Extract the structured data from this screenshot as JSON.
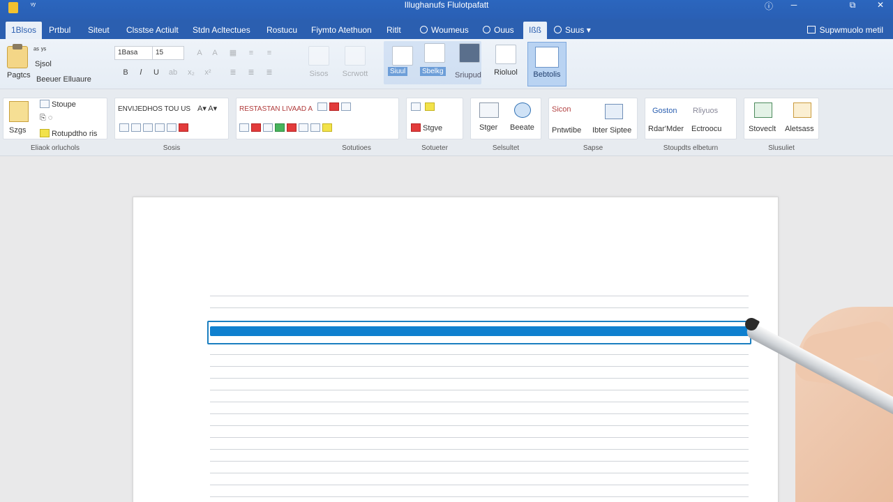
{
  "window": {
    "title": "Illughanufs  Flulotpafatt",
    "quick_access": "ᵛʸ",
    "buttons": {
      "help": "ⓘ",
      "minimize": "─",
      "restore": "⧉",
      "close": "✕"
    }
  },
  "tabs": [
    {
      "label": "1Blsos"
    },
    {
      "label": "Prtbul"
    },
    {
      "label": "Siteut"
    },
    {
      "label": "Clsstse Actiult"
    },
    {
      "label": "Stdn Acltectues"
    },
    {
      "label": "Rostucu"
    },
    {
      "label": "Fiymto Atethuon"
    },
    {
      "label": "Ritlt"
    },
    {
      "label": "Woumeus"
    },
    {
      "label": "Ouus"
    },
    {
      "label": "Ißß"
    },
    {
      "label": "Suus"
    }
  ],
  "share_label": "Supwmuolo metil",
  "ribbon_top": {
    "clipboard": {
      "paste": "Pagtcs",
      "line1": "ᵃˢ ʸˢ",
      "line2": "Sjsol",
      "line3": "Beeuer Elluaure"
    },
    "font_box": "1Basa",
    "size_box": "15",
    "big_buttons": [
      {
        "label": "Sisos"
      },
      {
        "label": "Scrwott"
      }
    ],
    "selection_labels": [
      "Siuul",
      "Sbelkg",
      "Sriupud"
    ],
    "extra_label": "Rioluol",
    "headers_label": "Bebtolis"
  },
  "ribbon_bottom": {
    "groups": [
      {
        "caption": "Eliaok orluchols",
        "items": [
          "Stoupe",
          "Szgs",
          "Rotupdtho ris"
        ]
      },
      {
        "caption": "Sosis",
        "items": [
          "ENVIJEDHOS TOU US"
        ]
      },
      {
        "caption": "Sotutioes",
        "items": [
          "RESTASTAN LIVAAD A"
        ]
      },
      {
        "caption": "Sotueter",
        "items": [
          "Stgve"
        ]
      },
      {
        "caption": "Selsultet",
        "items": [
          "Stger",
          "Beeate"
        ]
      },
      {
        "caption": "Sapse",
        "items": [
          "Sicon",
          "Pntwtibe",
          "Ibter Siptee"
        ]
      },
      {
        "caption": "Stoupdts elbeturn",
        "items": [
          "Goston",
          "Rliyuos",
          "Rdar'Mder",
          "Ectroocu"
        ]
      },
      {
        "caption": "Slusuliet",
        "items": [
          "Stoveclt",
          "Aletsass"
        ]
      }
    ]
  },
  "colors": {
    "titlebar": "#2b66be",
    "highlight": "#0f80cf",
    "frame": "#1a7ec0"
  }
}
